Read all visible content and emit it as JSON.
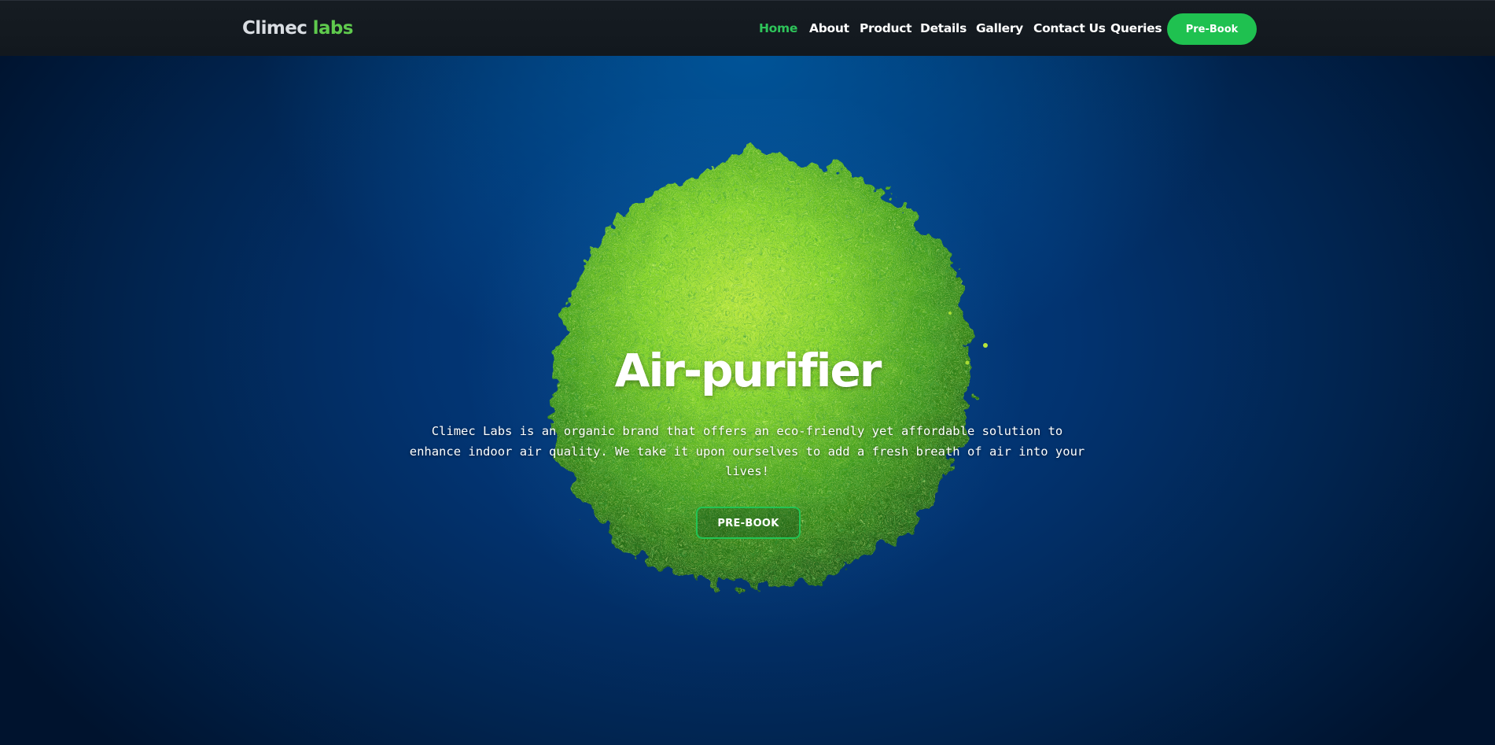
{
  "brand": {
    "name_main": "Climec ",
    "name_accent": "labs"
  },
  "nav": {
    "items": [
      {
        "label": "Home",
        "active": true
      },
      {
        "label": "About",
        "active": false
      },
      {
        "label": "Product",
        "active": false
      },
      {
        "label": "Details",
        "active": false
      },
      {
        "label": "Gallery",
        "active": false
      },
      {
        "label": "Contact Us",
        "active": false
      },
      {
        "label": "Queries",
        "active": false
      }
    ],
    "cta_label": "Pre-Book"
  },
  "hero": {
    "title": "Air-purifier",
    "description": "Climec Labs is an organic brand that offers an eco-friendly yet affordable solution to enhance indoor air quality. We take it upon ourselves to add a fresh breath of air into your lives!",
    "button_label": "PRE-BOOK",
    "background_image": "green-moss-sphere"
  },
  "colors": {
    "accent_green": "#1fc150",
    "active_nav": "#2ec45a",
    "navbar_bg": "#14191f",
    "hero_bg": "#013570"
  }
}
